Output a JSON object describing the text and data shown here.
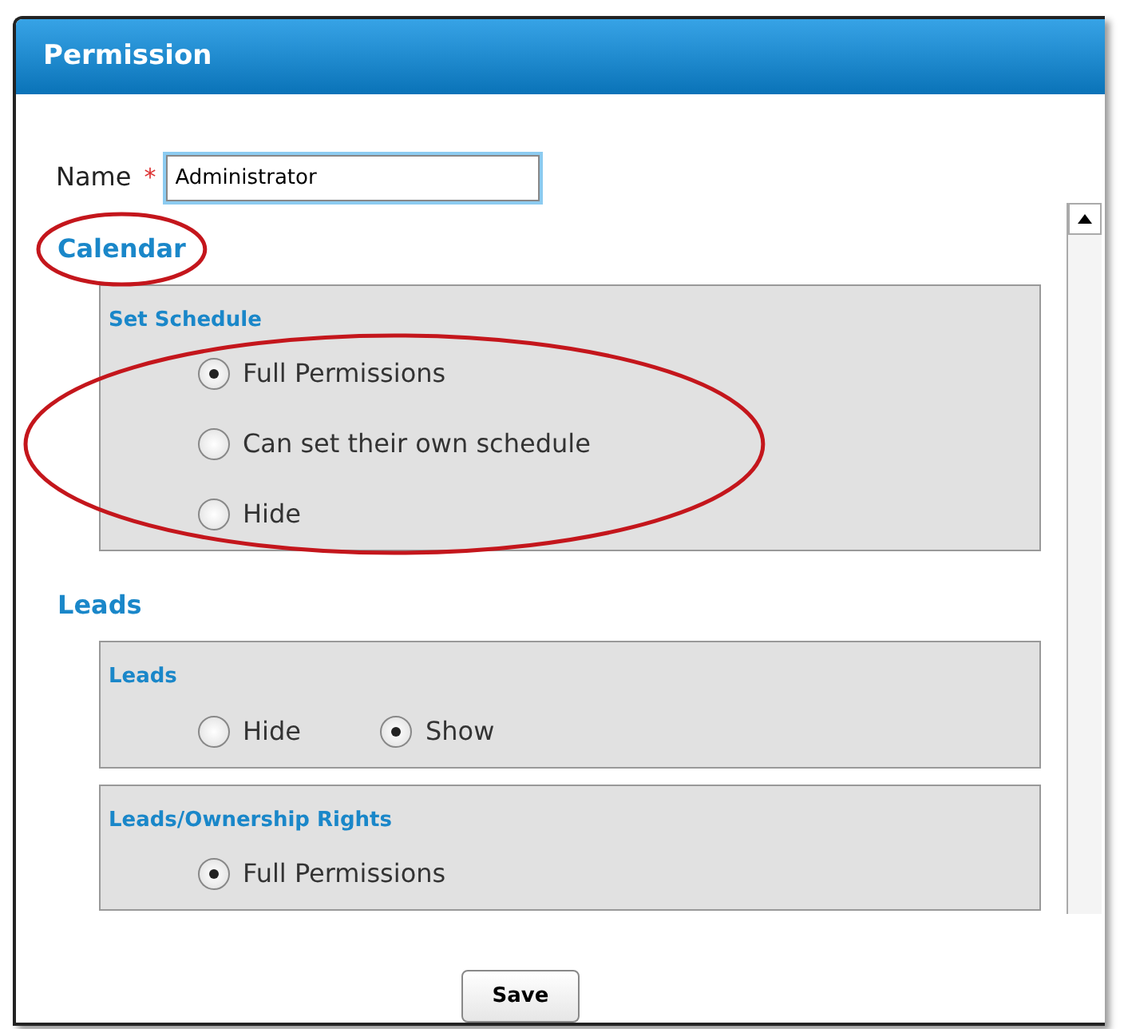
{
  "window": {
    "title": "Permission"
  },
  "name_field": {
    "label": "Name",
    "required_mark": "*",
    "value": "Administrator"
  },
  "sections": [
    {
      "heading": "Calendar",
      "highlighted": true,
      "groups": [
        {
          "title": "Set Schedule",
          "kind": "vertical",
          "highlighted": true,
          "options": [
            {
              "label": "Full Permissions",
              "selected": true
            },
            {
              "label": "Can set their own schedule",
              "selected": false
            },
            {
              "label": "Hide",
              "selected": false
            }
          ]
        }
      ]
    },
    {
      "heading": "Leads",
      "highlighted": false,
      "groups": [
        {
          "title": "Leads",
          "kind": "horizontal",
          "highlighted": false,
          "options": [
            {
              "label": "Hide",
              "selected": false
            },
            {
              "label": "Show",
              "selected": true
            }
          ]
        },
        {
          "title": "Leads/Ownership Rights",
          "kind": "vertical",
          "highlighted": false,
          "options": [
            {
              "label": "Full Permissions",
              "selected": true
            }
          ]
        }
      ]
    }
  ],
  "buttons": [
    {
      "label": "Save"
    }
  ]
}
